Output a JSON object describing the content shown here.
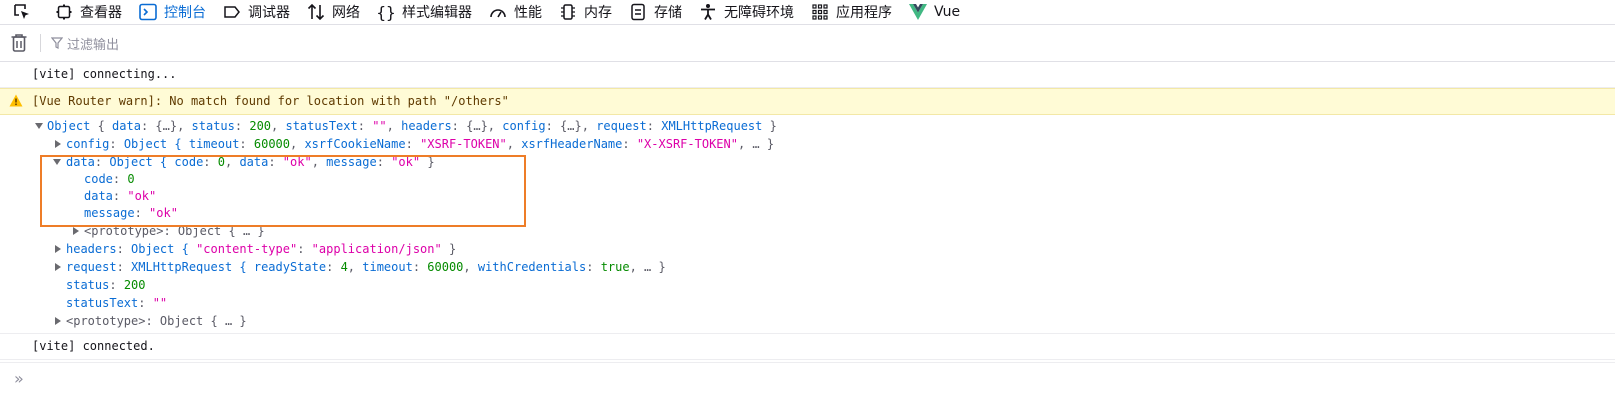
{
  "tabs": [
    {
      "label": "",
      "icon": "element-picker-icon"
    },
    {
      "label": "查看器",
      "icon": "inspector-icon"
    },
    {
      "label": "控制台",
      "icon": "console-icon",
      "selected": true
    },
    {
      "label": "调试器",
      "icon": "debugger-icon"
    },
    {
      "label": "网络",
      "icon": "network-icon"
    },
    {
      "label": "样式编辑器",
      "icon": "style-editor-icon"
    },
    {
      "label": "性能",
      "icon": "performance-icon"
    },
    {
      "label": "内存",
      "icon": "memory-icon"
    },
    {
      "label": "存储",
      "icon": "storage-icon"
    },
    {
      "label": "无障碍环境",
      "icon": "accessibility-icon"
    },
    {
      "label": "应用程序",
      "icon": "application-icon"
    },
    {
      "label": "Vue",
      "icon": "vue-icon"
    }
  ],
  "filter": {
    "placeholder": "过滤输出"
  },
  "messages": {
    "connecting": "[vite] connecting...",
    "warn": "[Vue Router warn]: No match found for location with path \"/others\"",
    "connected": "[vite] connected."
  },
  "tree": {
    "root": {
      "label": "Object",
      "preview": [
        {
          "t": "g",
          "v": " { "
        },
        {
          "t": "k",
          "v": "data"
        },
        {
          "t": "g",
          "v": ": {…}, "
        },
        {
          "t": "k",
          "v": "status"
        },
        {
          "t": "g",
          "v": ": "
        },
        {
          "t": "n",
          "v": "200"
        },
        {
          "t": "g",
          "v": ", "
        },
        {
          "t": "k",
          "v": "statusText"
        },
        {
          "t": "g",
          "v": ": "
        },
        {
          "t": "s",
          "v": "\"\""
        },
        {
          "t": "g",
          "v": ", "
        },
        {
          "t": "k",
          "v": "headers"
        },
        {
          "t": "g",
          "v": ": {…}, "
        },
        {
          "t": "k",
          "v": "config"
        },
        {
          "t": "g",
          "v": ": {…}, "
        },
        {
          "t": "k",
          "v": "request"
        },
        {
          "t": "g",
          "v": ": "
        },
        {
          "t": "o",
          "v": "XMLHttpRequest"
        },
        {
          "t": "g",
          "v": " }"
        }
      ]
    },
    "config": {
      "key": "config",
      "preview": [
        {
          "t": "g",
          "v": ": "
        },
        {
          "t": "o",
          "v": "Object { "
        },
        {
          "t": "k",
          "v": "timeout"
        },
        {
          "t": "g",
          "v": ": "
        },
        {
          "t": "n",
          "v": "60000"
        },
        {
          "t": "g",
          "v": ", "
        },
        {
          "t": "k",
          "v": "xsrfCookieName"
        },
        {
          "t": "g",
          "v": ": "
        },
        {
          "t": "s",
          "v": "\"XSRF-TOKEN\""
        },
        {
          "t": "g",
          "v": ", "
        },
        {
          "t": "k",
          "v": "xsrfHeaderName"
        },
        {
          "t": "g",
          "v": ": "
        },
        {
          "t": "s",
          "v": "\"X-XSRF-TOKEN\""
        },
        {
          "t": "g",
          "v": ", … }"
        }
      ]
    },
    "data": {
      "key": "data",
      "preview": [
        {
          "t": "g",
          "v": ": "
        },
        {
          "t": "o",
          "v": "Object { "
        },
        {
          "t": "k",
          "v": "code"
        },
        {
          "t": "g",
          "v": ": "
        },
        {
          "t": "n",
          "v": "0"
        },
        {
          "t": "g",
          "v": ", "
        },
        {
          "t": "k",
          "v": "data"
        },
        {
          "t": "g",
          "v": ": "
        },
        {
          "t": "s",
          "v": "\"ok\""
        },
        {
          "t": "g",
          "v": ", "
        },
        {
          "t": "k",
          "v": "message"
        },
        {
          "t": "g",
          "v": ": "
        },
        {
          "t": "s",
          "v": "\"ok\""
        },
        {
          "t": "g",
          "v": " }"
        }
      ],
      "children": [
        {
          "key": "code",
          "value": "0",
          "t": "n"
        },
        {
          "key": "data",
          "value": "\"ok\"",
          "t": "s"
        },
        {
          "key": "message",
          "value": "\"ok\"",
          "t": "s"
        }
      ],
      "prototype": "<prototype>: Object { … }"
    },
    "headers": {
      "key": "headers",
      "preview": [
        {
          "t": "g",
          "v": ": "
        },
        {
          "t": "o",
          "v": "Object { "
        },
        {
          "t": "s",
          "v": "\"content-type\""
        },
        {
          "t": "g",
          "v": ": "
        },
        {
          "t": "s",
          "v": "\"application/json\""
        },
        {
          "t": "g",
          "v": " }"
        }
      ]
    },
    "request": {
      "key": "request",
      "preview": [
        {
          "t": "g",
          "v": ": "
        },
        {
          "t": "o",
          "v": "XMLHttpRequest { "
        },
        {
          "t": "k",
          "v": "readyState"
        },
        {
          "t": "g",
          "v": ": "
        },
        {
          "t": "n",
          "v": "4"
        },
        {
          "t": "g",
          "v": ", "
        },
        {
          "t": "k",
          "v": "timeout"
        },
        {
          "t": "g",
          "v": ": "
        },
        {
          "t": "n",
          "v": "60000"
        },
        {
          "t": "g",
          "v": ", "
        },
        {
          "t": "k",
          "v": "withCredentials"
        },
        {
          "t": "g",
          "v": ": "
        },
        {
          "t": "b",
          "v": "true"
        },
        {
          "t": "g",
          "v": ", … }"
        }
      ]
    },
    "status": {
      "key": "status",
      "value": "200"
    },
    "statusText": {
      "key": "statusText",
      "value": "\"\""
    },
    "prototype": "<prototype>: Object { … }"
  },
  "colors": {
    "accent": "#0a6cd4",
    "highlight_border": "#ee7d28",
    "warn_bg": "#fffbd6"
  }
}
